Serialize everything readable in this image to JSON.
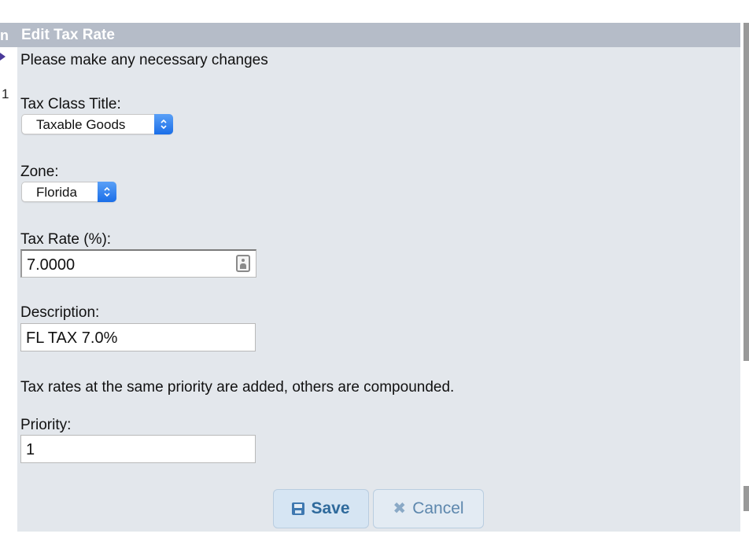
{
  "left_strip": {
    "header_fragment": "n",
    "row_number": "1"
  },
  "dialog": {
    "title": "Edit Tax Rate",
    "intro": "Please make any necessary changes",
    "tax_class": {
      "label": "Tax Class Title:",
      "selected": "Taxable Goods"
    },
    "zone": {
      "label": "Zone:",
      "selected": "Florida"
    },
    "tax_rate": {
      "label": "Tax Rate (%):",
      "value": "7.0000"
    },
    "description": {
      "label": "Description:",
      "value": "FL TAX 7.0%"
    },
    "priority_note": "Tax rates at the same priority are added, others are compounded.",
    "priority": {
      "label": "Priority:",
      "value": "1"
    },
    "buttons": {
      "save": "Save",
      "cancel": "Cancel"
    }
  },
  "colors": {
    "header_bg": "#b5bcc8",
    "panel_bg": "#e3e7ec",
    "select_accent": "#1a6ee8"
  }
}
